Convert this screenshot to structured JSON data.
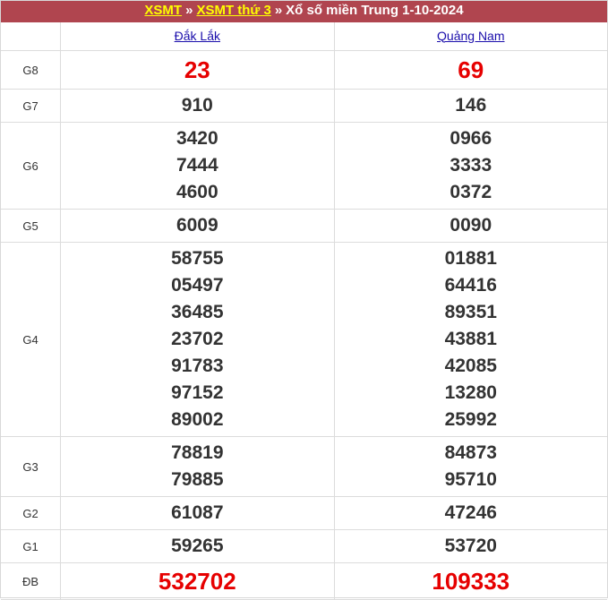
{
  "breadcrumb": {
    "link1": "XSMT",
    "link2": "XSMT thứ 3",
    "separator": "»",
    "title": "Xổ số miền Trung 1-10-2024"
  },
  "provinces": [
    "Đắk Lắk",
    "Quảng Nam"
  ],
  "rows": [
    {
      "label": "G8",
      "a": [
        "23"
      ],
      "b": [
        "69"
      ],
      "style": "red"
    },
    {
      "label": "G7",
      "a": [
        "910"
      ],
      "b": [
        "146"
      ]
    },
    {
      "label": "G6",
      "a": [
        "3420",
        "7444",
        "4600"
      ],
      "b": [
        "0966",
        "3333",
        "0372"
      ]
    },
    {
      "label": "G5",
      "a": [
        "6009"
      ],
      "b": [
        "0090"
      ]
    },
    {
      "label": "G4",
      "a": [
        "58755",
        "05497",
        "36485",
        "23702",
        "91783",
        "97152",
        "89002"
      ],
      "b": [
        "01881",
        "64416",
        "89351",
        "43881",
        "42085",
        "13280",
        "25992"
      ]
    },
    {
      "label": "G3",
      "a": [
        "78819",
        "79885"
      ],
      "b": [
        "84873",
        "95710"
      ]
    },
    {
      "label": "G2",
      "a": [
        "61087"
      ],
      "b": [
        "47246"
      ]
    },
    {
      "label": "G1",
      "a": [
        "59265"
      ],
      "b": [
        "53720"
      ]
    },
    {
      "label": "ĐB",
      "a": [
        "532702"
      ],
      "b": [
        "109333"
      ],
      "style": "db"
    }
  ],
  "colors": {
    "header_bg": "#b0454f",
    "link_yellow": "#ffff00",
    "highlight_red": "#e60000",
    "text": "#333333"
  }
}
